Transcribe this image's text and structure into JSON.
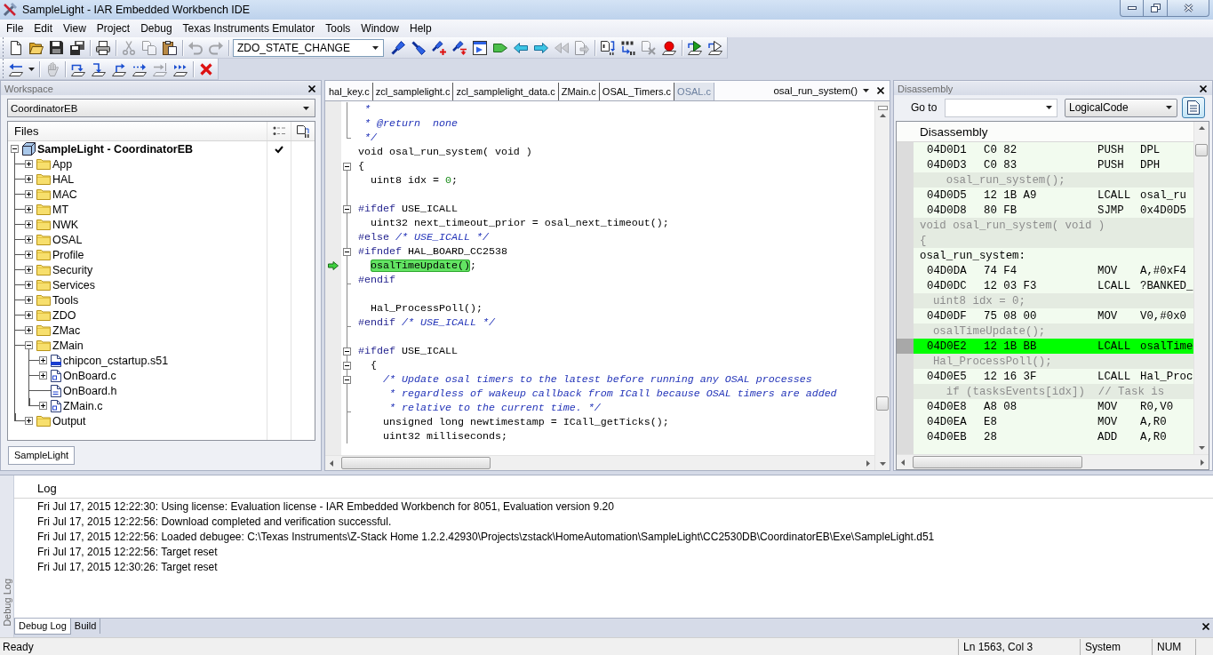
{
  "window": {
    "title": "SampleLight - IAR Embedded Workbench IDE"
  },
  "menu": [
    "File",
    "Edit",
    "View",
    "Project",
    "Debug",
    "Texas Instruments Emulator",
    "Tools",
    "Window",
    "Help"
  ],
  "toolbars": [
    {
      "groups": [
        {
          "kind": "buttons",
          "buttons": [
            {
              "kind": "page",
              "disabled": false
            },
            {
              "kind": "folder",
              "disabled": false
            },
            {
              "kind": "floppy",
              "disabled": false
            },
            {
              "kind": "floppies",
              "disabled": false
            }
          ]
        },
        {
          "kind": "buttons",
          "buttons": [
            {
              "kind": "printer",
              "disabled": false
            }
          ]
        },
        {
          "kind": "buttons",
          "buttons": [
            {
              "kind": "scissors",
              "disabled": true
            },
            {
              "kind": "pages",
              "disabled": true
            },
            {
              "kind": "clipboard",
              "disabled": false
            }
          ]
        },
        {
          "kind": "buttons",
          "buttons": [
            {
              "kind": "undo",
              "disabled": true
            },
            {
              "kind": "redo",
              "disabled": true
            }
          ]
        },
        {
          "kind": "combo",
          "value": "ZDO_STATE_CHANGE"
        },
        {
          "kind": "buttons",
          "buttons": [
            {
              "kind": "torch",
              "disabled": false
            },
            {
              "kind": "torchdown",
              "disabled": false
            },
            {
              "kind": "torchplus",
              "disabled": false
            },
            {
              "kind": "torcharrow",
              "disabled": false
            },
            {
              "kind": "window",
              "disabled": false
            },
            {
              "kind": "tag",
              "disabled": false
            },
            {
              "kind": "leftarrow",
              "disabled": false
            },
            {
              "kind": "rightarrow",
              "disabled": false
            },
            {
              "kind": "leftarrows",
              "disabled": true
            },
            {
              "kind": "pagearrow",
              "disabled": true
            }
          ]
        },
        {
          "kind": "buttons",
          "buttons": [
            {
              "kind": "pagebits",
              "disabled": false
            },
            {
              "kind": "bitsarrow",
              "disabled": false
            },
            {
              "kind": "bitscross",
              "disabled": true
            },
            {
              "kind": "breakpoint",
              "disabled": false
            }
          ]
        },
        {
          "kind": "buttons",
          "buttons": [
            {
              "kind": "play",
              "disabled": false
            },
            {
              "kind": "playoutline",
              "disabled": false
            }
          ]
        }
      ]
    },
    {
      "groups": [
        {
          "kind": "buttons",
          "buttons": [
            {
              "kind": "stepback",
              "disabled": false
            },
            {
              "kind": "caret",
              "disabled": false
            }
          ]
        },
        {
          "kind": "buttons",
          "buttons": [
            {
              "kind": "hand",
              "disabled": true
            }
          ]
        },
        {
          "kind": "buttons",
          "buttons": [
            {
              "kind": "stepover",
              "disabled": false
            },
            {
              "kind": "stepinto",
              "disabled": false
            },
            {
              "kind": "stepout",
              "disabled": false
            },
            {
              "kind": "nextstatement",
              "disabled": false
            },
            {
              "kind": "runtocursor",
              "disabled": true
            },
            {
              "kind": "go",
              "disabled": false
            }
          ]
        },
        {
          "kind": "buttons",
          "buttons": [
            {
              "kind": "stop",
              "disabled": false
            }
          ]
        }
      ]
    }
  ],
  "workspace": {
    "title": "Workspace",
    "configuration": "CoordinatorEB",
    "column_header": "Files",
    "tree": [
      {
        "label": "SampleLight - CoordinatorEB",
        "kind": "project",
        "expanded": true,
        "checked": true,
        "children": [
          {
            "label": "App",
            "kind": "folder",
            "expanded": false
          },
          {
            "label": "HAL",
            "kind": "folder",
            "expanded": false
          },
          {
            "label": "MAC",
            "kind": "folder",
            "expanded": false
          },
          {
            "label": "MT",
            "kind": "folder",
            "expanded": false
          },
          {
            "label": "NWK",
            "kind": "folder",
            "expanded": false
          },
          {
            "label": "OSAL",
            "kind": "folder",
            "expanded": false
          },
          {
            "label": "Profile",
            "kind": "folder",
            "expanded": false
          },
          {
            "label": "Security",
            "kind": "folder",
            "expanded": false
          },
          {
            "label": "Services",
            "kind": "folder",
            "expanded": false
          },
          {
            "label": "Tools",
            "kind": "folder",
            "expanded": false
          },
          {
            "label": "ZDO",
            "kind": "folder",
            "expanded": false
          },
          {
            "label": "ZMac",
            "kind": "folder",
            "expanded": false
          },
          {
            "label": "ZMain",
            "kind": "folder",
            "expanded": true,
            "children": [
              {
                "label": "chipcon_cstartup.s51",
                "kind": "assembly",
                "expanded": false,
                "leaf": false
              },
              {
                "label": "OnBoard.c",
                "kind": "source",
                "expanded": false,
                "leaf": false
              },
              {
                "label": "OnBoard.h",
                "kind": "header",
                "leaf": true
              },
              {
                "label": "ZMain.c",
                "kind": "source",
                "expanded": false,
                "leaf": false
              }
            ]
          },
          {
            "label": "Output",
            "kind": "folder",
            "expanded": false
          }
        ]
      }
    ],
    "tabs": [
      {
        "label": "SampleLight",
        "selected": true
      }
    ]
  },
  "editor": {
    "tabs": [
      {
        "label": "hal_key.c",
        "selected": false
      },
      {
        "label": "zcl_samplelight.c",
        "selected": false
      },
      {
        "label": "zcl_samplelight_data.c",
        "selected": false
      },
      {
        "label": "ZMain.c",
        "selected": false
      },
      {
        "label": "OSAL_Timers.c",
        "selected": false
      },
      {
        "label": "OSAL.c",
        "selected": true
      }
    ],
    "function": "osal_run_system()",
    "lines": [
      {
        "guide": true,
        "fold_box": false,
        "fold_end": false,
        "current": false,
        "tokens": [
          {
            "text": " *",
            "kind": "comment"
          }
        ]
      },
      {
        "guide": true,
        "fold_box": false,
        "fold_end": false,
        "current": false,
        "tokens": [
          {
            "text": " * @return  none",
            "kind": "comment"
          }
        ]
      },
      {
        "guide": true,
        "fold_box": false,
        "fold_end": true,
        "current": false,
        "tokens": [
          {
            "text": " */",
            "kind": "comment"
          }
        ]
      },
      {
        "guide": false,
        "fold_box": false,
        "fold_end": false,
        "current": false,
        "tokens": [
          {
            "text": "void osal_run_system( void )",
            "kind": "plain"
          }
        ]
      },
      {
        "guide": true,
        "fold_box": true,
        "fold_end": false,
        "current": false,
        "tokens": [
          {
            "text": "{",
            "kind": "plain"
          }
        ]
      },
      {
        "guide": true,
        "fold_box": false,
        "fold_end": false,
        "current": false,
        "tokens": [
          {
            "text": "  uint8 idx = ",
            "kind": "plain"
          },
          {
            "text": "0",
            "kind": "number"
          },
          {
            "text": ";",
            "kind": "plain"
          }
        ]
      },
      {
        "guide": true,
        "fold_box": false,
        "fold_end": false,
        "current": false
      },
      {
        "guide": true,
        "fold_box": true,
        "fold_end": false,
        "current": false,
        "tokens": [
          {
            "text": "#ifdef",
            "kind": "preprocessor"
          },
          {
            "text": " USE_ICALL",
            "kind": "plain"
          }
        ]
      },
      {
        "guide": true,
        "fold_box": false,
        "fold_end": false,
        "current": false,
        "tokens": [
          {
            "text": "  uint32 next_timeout_prior = osal_next_timeout();",
            "kind": "plain"
          }
        ]
      },
      {
        "guide": true,
        "fold_box": false,
        "fold_end": false,
        "current": false,
        "tokens": [
          {
            "text": "#else",
            "kind": "preprocessor"
          },
          {
            "text": " /* USE_ICALL */",
            "kind": "comment"
          }
        ]
      },
      {
        "guide": true,
        "fold_box": true,
        "fold_end": false,
        "current": false,
        "tokens": [
          {
            "text": "#ifndef",
            "kind": "preprocessor"
          },
          {
            "text": " HAL_BOARD_CC2538",
            "kind": "plain"
          }
        ]
      },
      {
        "guide": true,
        "fold_box": false,
        "fold_end": false,
        "current": true,
        "tokens": [
          {
            "text": "  osalTimeUpdate()",
            "kind": "highlight"
          },
          {
            "text": ";",
            "kind": "plain"
          }
        ]
      },
      {
        "guide": true,
        "fold_box": false,
        "fold_end": true,
        "current": false,
        "tokens": [
          {
            "text": "#endif",
            "kind": "preprocessor"
          }
        ]
      },
      {
        "guide": true,
        "fold_box": false,
        "fold_end": false,
        "current": false
      },
      {
        "guide": true,
        "fold_box": false,
        "fold_end": false,
        "current": false,
        "tokens": [
          {
            "text": "  Hal_ProcessPoll();",
            "kind": "plain"
          }
        ]
      },
      {
        "guide": true,
        "fold_box": false,
        "fold_end": true,
        "current": false,
        "tokens": [
          {
            "text": "#endif",
            "kind": "preprocessor"
          },
          {
            "text": " /* USE_ICALL */",
            "kind": "comment"
          }
        ]
      },
      {
        "guide": true,
        "fold_box": false,
        "fold_end": false,
        "current": false
      },
      {
        "guide": true,
        "fold_box": true,
        "fold_end": false,
        "current": false,
        "tokens": [
          {
            "text": "#ifdef",
            "kind": "preprocessor"
          },
          {
            "text": " USE_ICALL",
            "kind": "plain"
          }
        ]
      },
      {
        "guide": true,
        "fold_box": true,
        "fold_end": false,
        "current": false,
        "tokens": [
          {
            "text": "  {",
            "kind": "plain"
          }
        ]
      },
      {
        "guide": true,
        "fold_box": true,
        "fold_end": false,
        "current": false,
        "tokens": [
          {
            "text": "    /* Update osal timers to the latest before running any OSAL processes",
            "kind": "comment"
          }
        ]
      },
      {
        "guide": true,
        "fold_box": false,
        "fold_end": false,
        "current": false,
        "tokens": [
          {
            "text": "     * regardless of wakeup callback from ICall because OSAL timers are added",
            "kind": "comment"
          }
        ]
      },
      {
        "guide": true,
        "fold_box": false,
        "fold_end": true,
        "current": false,
        "tokens": [
          {
            "text": "     * relative to the current time. */",
            "kind": "comment"
          }
        ]
      },
      {
        "guide": true,
        "fold_box": false,
        "fold_end": false,
        "current": false,
        "tokens": [
          {
            "text": "    unsigned long newtimestamp = ICall_getTicks();",
            "kind": "plain"
          }
        ]
      },
      {
        "guide": true,
        "fold_box": false,
        "fold_end": false,
        "current": false,
        "tokens": [
          {
            "text": "    uint32 milliseconds;",
            "kind": "plain"
          }
        ]
      }
    ]
  },
  "disassembly": {
    "title": "Disassembly",
    "goto_label": "Go to",
    "view_mode": "LogicalCode",
    "column_header": "Disassembly",
    "rows": [
      {
        "kind": "code",
        "address": "04D0D1",
        "bytes": "C0 82",
        "mnemonic": "PUSH",
        "operand": "DPL",
        "current": false
      },
      {
        "kind": "code",
        "address": "04D0D3",
        "bytes": "C0 83",
        "mnemonic": "PUSH",
        "operand": "DPH",
        "current": false
      },
      {
        "kind": "source",
        "text": "    osal_run_system();"
      },
      {
        "kind": "code",
        "address": "04D0D5",
        "bytes": "12 1B A9",
        "mnemonic": "LCALL",
        "operand": "osal_ru",
        "current": false
      },
      {
        "kind": "code",
        "address": "04D0D8",
        "bytes": "80 FB",
        "mnemonic": "SJMP",
        "operand": "0x4D0D5",
        "current": false
      },
      {
        "kind": "source",
        "text": "void osal_run_system( void )"
      },
      {
        "kind": "source",
        "text": "{"
      },
      {
        "kind": "label",
        "text": "osal_run_system:"
      },
      {
        "kind": "code",
        "address": "04D0DA",
        "bytes": "74 F4",
        "mnemonic": "MOV",
        "operand": "A,#0xF4",
        "current": false
      },
      {
        "kind": "code",
        "address": "04D0DC",
        "bytes": "12 03 F3",
        "mnemonic": "LCALL",
        "operand": "?BANKED_",
        "current": false
      },
      {
        "kind": "source",
        "text": "  uint8 idx = 0;"
      },
      {
        "kind": "code",
        "address": "04D0DF",
        "bytes": "75 08 00",
        "mnemonic": "MOV",
        "operand": "V0,#0x0",
        "current": false
      },
      {
        "kind": "source",
        "text": "  osalTimeUpdate();"
      },
      {
        "kind": "code",
        "address": "04D0E2",
        "bytes": "12 1B BB",
        "mnemonic": "LCALL",
        "operand": "osalTime",
        "current": true
      },
      {
        "kind": "source",
        "text": "  Hal_ProcessPoll();"
      },
      {
        "kind": "code",
        "address": "04D0E5",
        "bytes": "12 16 3F",
        "mnemonic": "LCALL",
        "operand": "Hal_Proc",
        "current": false
      },
      {
        "kind": "source",
        "text": "    if (tasksEvents[idx])  // Task is"
      },
      {
        "kind": "code",
        "address": "04D0E8",
        "bytes": "A8 08",
        "mnemonic": "MOV",
        "operand": "R0,V0",
        "current": false
      },
      {
        "kind": "code",
        "address": "04D0EA",
        "bytes": "E8",
        "mnemonic": "MOV",
        "operand": "A,R0",
        "current": false
      },
      {
        "kind": "code",
        "address": "04D0EB",
        "bytes": "28",
        "mnemonic": "ADD",
        "operand": "A,R0",
        "current": false
      }
    ]
  },
  "log": {
    "side_title": "Debug Log",
    "column_header": "Log",
    "lines": [
      "Fri Jul 17, 2015 12:22:30: Using license: Evaluation license - IAR Embedded Workbench for 8051, Evaluation version 9.20",
      "Fri Jul 17, 2015 12:22:56: Download completed and verification successful.",
      "Fri Jul 17, 2015 12:22:56: Loaded debugee: C:\\Texas Instruments\\Z-Stack Home 1.2.2.42930\\Projects\\zstack\\HomeAutomation\\SampleLight\\CC2530DB\\CoordinatorEB\\Exe\\SampleLight.d51",
      "Fri Jul 17, 2015 12:22:56: Target reset",
      "Fri Jul 17, 2015 12:30:26: Target reset"
    ],
    "tabs": [
      {
        "label": "Debug Log",
        "selected": true
      },
      {
        "label": "Build",
        "selected": false
      }
    ]
  },
  "status_bar": {
    "message": "Ready",
    "cursor": "Ln 1563, Col 3",
    "mode": "System",
    "keys": "NUM"
  }
}
